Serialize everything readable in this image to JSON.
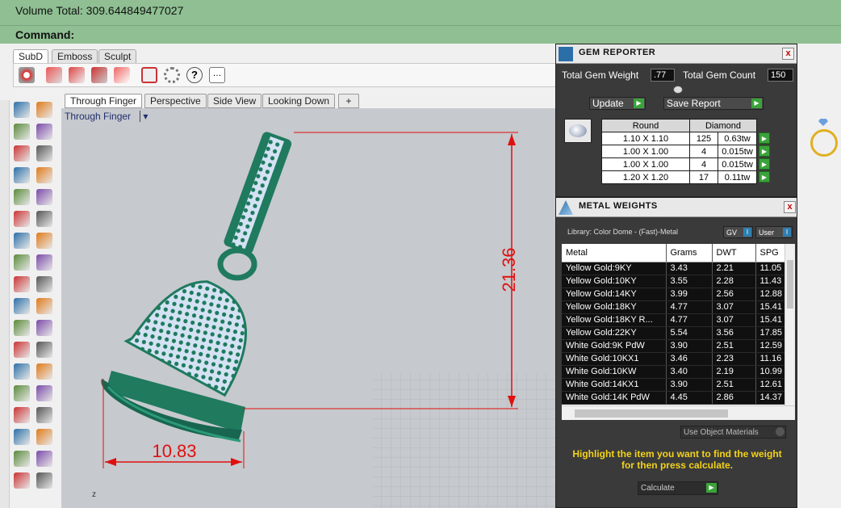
{
  "command": {
    "history": "Volume Total: 309.644849477027",
    "prompt": "Command:"
  },
  "toolbar_tabs": [
    "SubD",
    "Emboss",
    "Sculpt"
  ],
  "viewport_tabs": [
    "Through Finger",
    "Perspective",
    "Side View",
    "Looking Down"
  ],
  "viewport_add": "+",
  "viewport": {
    "title": "Through Finger",
    "dim_vertical": "21.36",
    "dim_horizontal": "10.83",
    "axis_label": "z"
  },
  "gem_reporter": {
    "title": "GEM REPORTER",
    "close": "x",
    "total_weight_label": "Total Gem Weight",
    "total_weight_value": ".77",
    "total_count_label": "Total Gem Count",
    "total_count_value": "150",
    "update_label": "Update",
    "save_label": "Save Report",
    "table_headers": [
      "Round",
      "Diamond"
    ],
    "rows": [
      {
        "size": "1.10 X 1.10",
        "count": "125",
        "weight": "0.63tw"
      },
      {
        "size": "1.00 X 1.00",
        "count": "4",
        "weight": "0.015tw"
      },
      {
        "size": "1.00 X 1.00",
        "count": "4",
        "weight": "0.015tw"
      },
      {
        "size": "1.20 X 1.20",
        "count": "17",
        "weight": "0.11tw"
      }
    ]
  },
  "metal_weights": {
    "title": "METAL WEIGHTS",
    "close": "x",
    "library": "Library: Color Dome - (Fast)-Metal",
    "gv_label": "GV",
    "user_label": "User",
    "headers": [
      "Metal",
      "Grams",
      "DWT",
      "SPG"
    ],
    "rows": [
      {
        "metal": "Yellow Gold:9KY",
        "grams": "3.43",
        "dwt": "2.21",
        "spg": "11.05"
      },
      {
        "metal": "Yellow Gold:10KY",
        "grams": "3.55",
        "dwt": "2.28",
        "spg": "11.43"
      },
      {
        "metal": "Yellow Gold:14KY",
        "grams": "3.99",
        "dwt": "2.56",
        "spg": "12.88"
      },
      {
        "metal": "Yellow Gold:18KY",
        "grams": "4.77",
        "dwt": "3.07",
        "spg": "15.41"
      },
      {
        "metal": "Yellow Gold:18KY R...",
        "grams": "4.77",
        "dwt": "3.07",
        "spg": "15.41"
      },
      {
        "metal": "Yellow Gold:22KY",
        "grams": "5.54",
        "dwt": "3.56",
        "spg": "17.85"
      },
      {
        "metal": "White Gold:9K PdW",
        "grams": "3.90",
        "dwt": "2.51",
        "spg": "12.59"
      },
      {
        "metal": "White Gold:10KX1",
        "grams": "3.46",
        "dwt": "2.23",
        "spg": "11.16"
      },
      {
        "metal": "White Gold:10KW",
        "grams": "3.40",
        "dwt": "2.19",
        "spg": "10.99"
      },
      {
        "metal": "White Gold:14KX1",
        "grams": "3.90",
        "dwt": "2.51",
        "spg": "12.61"
      },
      {
        "metal": "White Gold:14K PdW",
        "grams": "4.45",
        "dwt": "2.86",
        "spg": "14.37"
      }
    ],
    "use_object_materials": "Use Object Materials",
    "hint": "Highlight the item you want to find the weight for then press calculate.",
    "calculate_label": "Calculate"
  },
  "colors": {
    "command_bg": "#8fbf92",
    "viewport_bg": "#c6c9cd",
    "model_green": "#1f7a5e",
    "dimension_red": "#e01010",
    "panel_bg": "#3a3a3a",
    "hint_yellow": "#f2d21a"
  }
}
